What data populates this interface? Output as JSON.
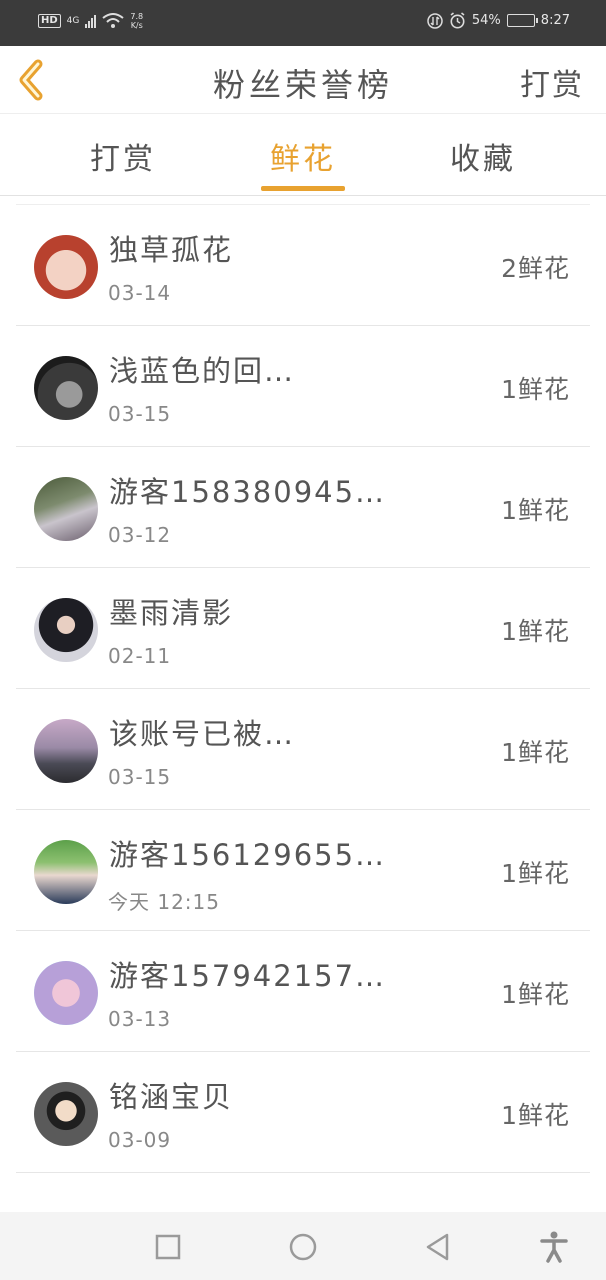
{
  "status": {
    "net_type": "4G",
    "hd": "HD",
    "speed_value": "7.8",
    "speed_unit": "K/s",
    "battery": "54%",
    "battery_level": 0.54,
    "time": "8:27"
  },
  "header": {
    "title": "粉丝荣誉榜",
    "right_link": "打赏"
  },
  "tabs": [
    {
      "label": "打赏",
      "active": false
    },
    {
      "label": "鲜花",
      "active": true
    },
    {
      "label": "收藏",
      "active": false
    }
  ],
  "colors": {
    "accent": "#e8a230",
    "statusbar": "#3b3b3b"
  },
  "rows": [
    {
      "name": "独草孤花",
      "date": "03-14",
      "count": "2鲜花"
    },
    {
      "name": "浅蓝色的回…",
      "date": "03-15",
      "count": "1鲜花"
    },
    {
      "name": "游客158380945…",
      "date": "03-12",
      "count": "1鲜花"
    },
    {
      "name": "墨雨清影",
      "date": "02-11",
      "count": "1鲜花"
    },
    {
      "name": "该账号已被…",
      "date": "03-15",
      "count": "1鲜花"
    },
    {
      "name": "游客156129655…",
      "date": "今天 12:15",
      "count": "1鲜花"
    },
    {
      "name": "游客157942157…",
      "date": "03-13",
      "count": "1鲜花"
    },
    {
      "name": "铭涵宝贝",
      "date": "03-09",
      "count": "1鲜花"
    }
  ],
  "navbar": {
    "icons": [
      "recent-apps-icon",
      "home-icon",
      "back-icon",
      "accessibility-icon"
    ]
  }
}
